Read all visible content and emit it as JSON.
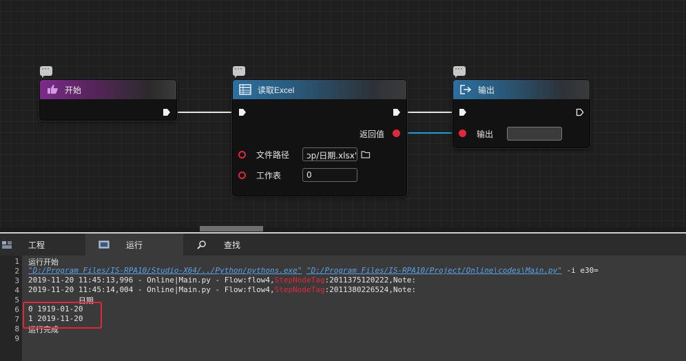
{
  "nodes": {
    "start": {
      "title": "开始",
      "icon": "hand-pointer-icon"
    },
    "read_excel": {
      "title": "读取Excel",
      "icon": "table-grid-icon",
      "return_label": "返回值",
      "file_path_label": "文件路径",
      "file_path_value": "ɔp/日期.xlsx'",
      "sheet_label": "工作表",
      "sheet_value": "0"
    },
    "output": {
      "title": "输出",
      "icon": "export-icon",
      "input_label": "输出",
      "input_value": ""
    }
  },
  "colors": {
    "exec_wire": "#e6e6e6",
    "data_wire": "#1e9fd6",
    "data_pin": "#e0283c",
    "start_header": "#7c2b8c",
    "excel_header": "#2c6f9f"
  },
  "tabs": [
    {
      "label": "工程",
      "icon": "project-icon"
    },
    {
      "label": "运行",
      "icon": "run-console-icon"
    },
    {
      "label": "查找",
      "icon": "search-icon"
    }
  ],
  "console": {
    "line_numbers": [
      "1",
      "2",
      "3",
      "4",
      "5",
      "6",
      "7",
      "8",
      "9"
    ],
    "line1": "运行开始",
    "line2_link1": "\"D:/Program Files/IS-RPA10/Studio-X64/../Python/pythons.exe\"",
    "line2_link2": "\"D:/Program Files/IS-RPA10/Project/Online\\codes\\Main.py\"",
    "line2_suffix": " -i e30=",
    "line3_prefix": "2019-11-20 11:45:13,996 - Online|Main.py - Flow:flow4,",
    "line3_tag": "StepNodeTag",
    "line3_suffix": ":2011375120222,Note:",
    "line4_prefix": "2019-11-20 11:45:14,004 - Online|Main.py - Flow:flow4,",
    "line4_tag": "StepNodeTag",
    "line4_suffix": ":2011380226524,Note:",
    "line5": "           日期",
    "line6": "0 1919-01-20",
    "line7": "1 2019-11-20",
    "line8": "运行完成"
  }
}
